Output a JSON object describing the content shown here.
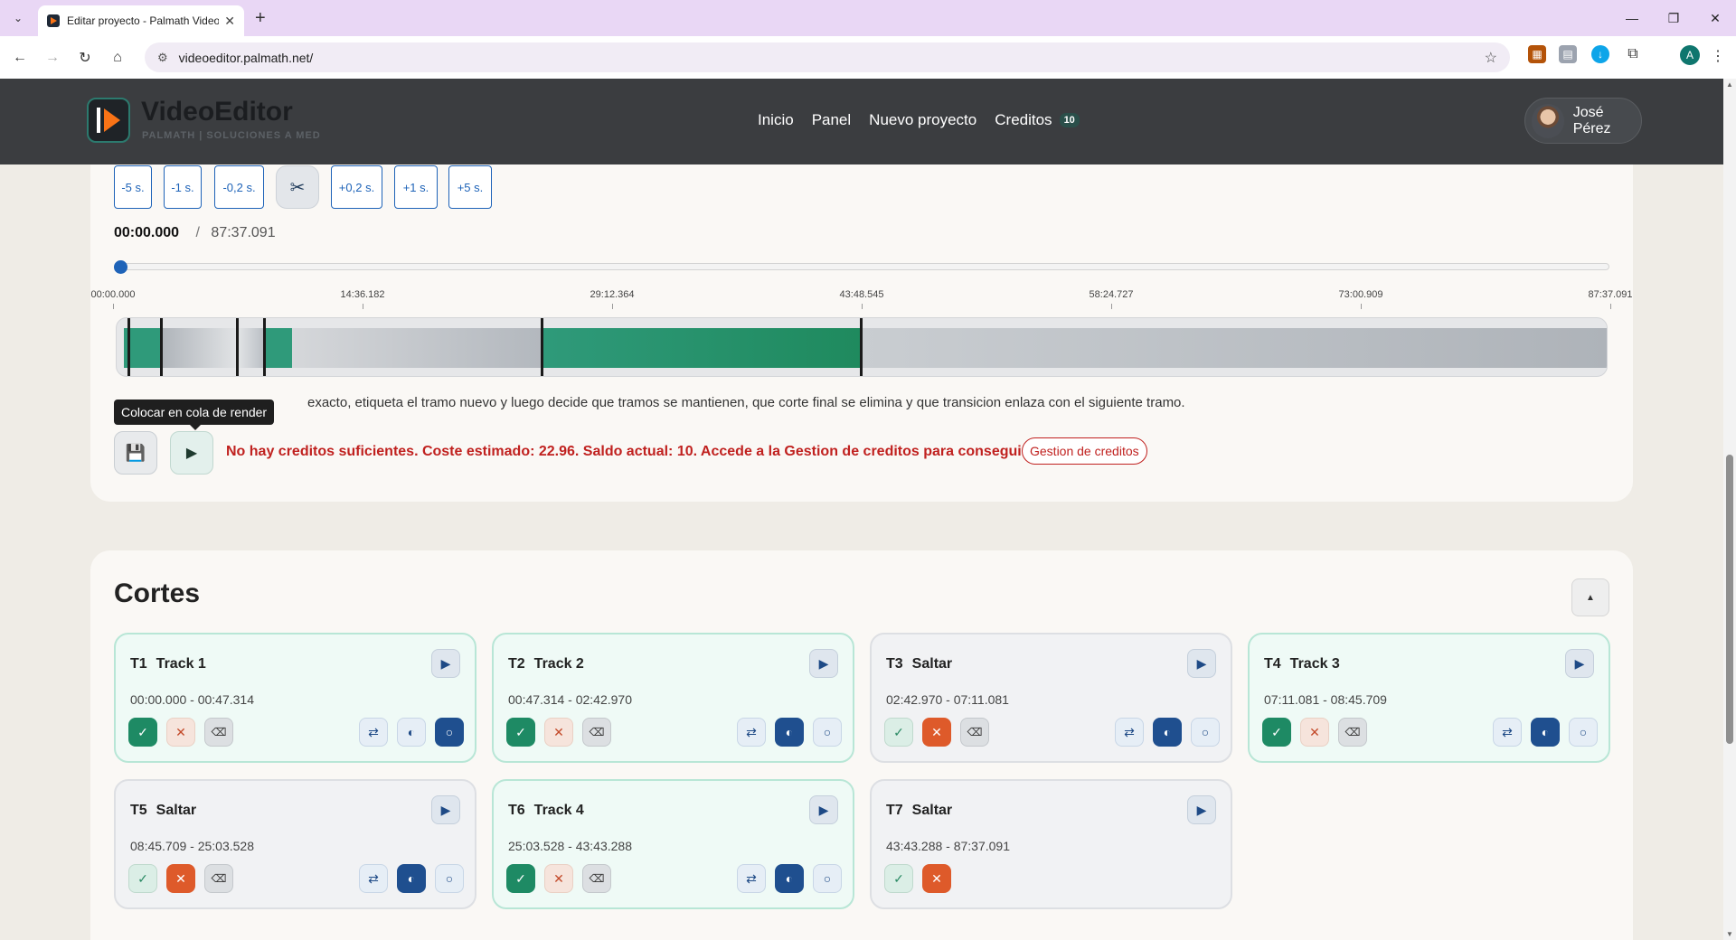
{
  "browser": {
    "tab_title": "Editar proyecto - Palmath Video",
    "url": "videoeditor.palmath.net/",
    "profile_initial": "A"
  },
  "app": {
    "brand_title": "VideoEditor",
    "brand_subtitle": "PALMATH | SOLUCIONES A MED",
    "nav": {
      "inicio": "Inicio",
      "panel": "Panel",
      "nuevo": "Nuevo proyecto",
      "creditos": "Creditos",
      "credit_count": "10"
    },
    "user_name": "José Pérez"
  },
  "editor": {
    "step_buttons": [
      "-5 s.",
      "-1 s.",
      "-0,2 s.",
      "+0,2 s.",
      "+1 s.",
      "+5 s."
    ],
    "current_time": "00:00.000",
    "separator": "/",
    "total_time": "87:37.091",
    "playhead_fraction": 0,
    "ruler_ticks": [
      "00:00.000",
      "14:36.182",
      "29:12.364",
      "43:48.545",
      "58:24.727",
      "73:00.909",
      "87:37.091"
    ],
    "help_text": "exacto, etiqueta el tramo nuevo y luego decide que tramos se mantienen, que corte final se elimina y que transicion enlaza con el siguiente tramo.",
    "tooltip": "Colocar en cola de render",
    "error_message": "No hay creditos suficientes. Coste estimado: 22.96. Saldo actual: 10. Accede a la Gestion de creditos para conseguir mas.",
    "credits_link": "Gestion de creditos",
    "colors": {
      "keep": "#2f9a7a",
      "skip": "#b9bec4",
      "accent": "#1e63b8",
      "error": "#c0211f"
    }
  },
  "cortes": {
    "title": "Cortes",
    "clips": [
      {
        "id": "T1",
        "name": "Track 1",
        "range": "00:00.000 - 00:47.314",
        "status": "keep",
        "transition": "circle"
      },
      {
        "id": "T2",
        "name": "Track 2",
        "range": "00:47.314 - 02:42.970",
        "status": "keep",
        "transition": "half"
      },
      {
        "id": "T3",
        "name": "Saltar",
        "range": "02:42.970 - 07:11.081",
        "status": "skip",
        "transition": "half"
      },
      {
        "id": "T4",
        "name": "Track 3",
        "range": "07:11.081 - 08:45.709",
        "status": "keep",
        "transition": "half"
      },
      {
        "id": "T5",
        "name": "Saltar",
        "range": "08:45.709 - 25:03.528",
        "status": "skip",
        "transition": "half"
      },
      {
        "id": "T6",
        "name": "Track 4",
        "range": "25:03.528 - 43:43.288",
        "status": "keep",
        "transition": "half"
      },
      {
        "id": "T7",
        "name": "Saltar",
        "range": "43:43.288 - 87:37.091",
        "status": "skip",
        "transition": "none"
      }
    ]
  }
}
